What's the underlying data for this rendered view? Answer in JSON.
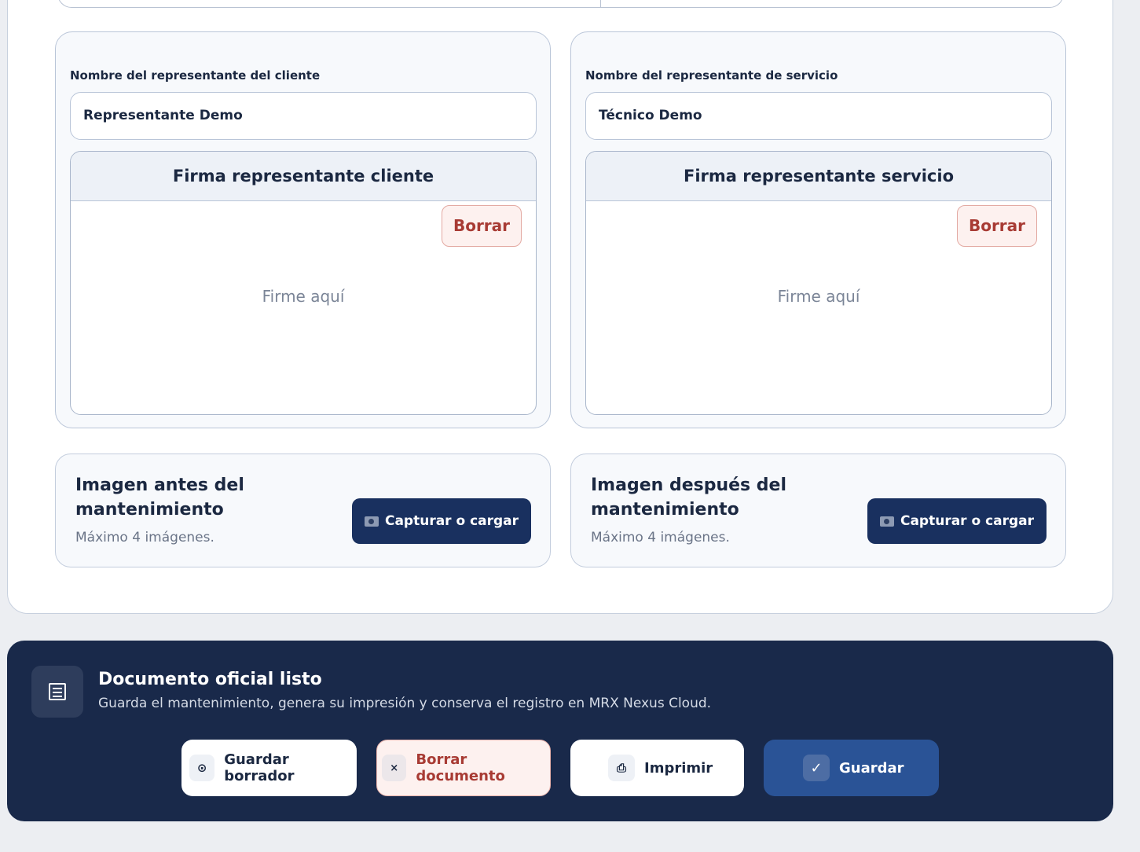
{
  "signatures": {
    "client": {
      "field_label": "Nombre del representante del cliente",
      "name_value": "Representante Demo",
      "box_title": "Firma representante cliente",
      "clear_label": "Borrar",
      "hint": "Firme aquí"
    },
    "service": {
      "field_label": "Nombre del representante de servicio",
      "name_value": "Técnico Demo",
      "box_title": "Firma representante servicio",
      "clear_label": "Borrar",
      "hint": "Firme aquí"
    }
  },
  "images": {
    "before": {
      "title": "Imagen antes del mantenimiento",
      "note": "Máximo 4 imágenes.",
      "button_label": "Capturar o cargar",
      "button_icon": "camera-icon"
    },
    "after": {
      "title": "Imagen después del mantenimiento",
      "note": "Máximo 4 imágenes.",
      "button_label": "Capturar o cargar",
      "button_icon": "camera-icon"
    }
  },
  "footer": {
    "icon": "document-list-icon",
    "title": "Documento oficial listo",
    "subtitle": "Guarda el mantenimiento, genera su impresión y conserva el registro en MRX Nexus Cloud.",
    "buttons": {
      "save_draft": {
        "label": "Guardar borrador",
        "icon": "disk-icon",
        "glyph": "⊙"
      },
      "delete_doc": {
        "label": "Borrar documento",
        "icon": "close-icon",
        "glyph": "×"
      },
      "print": {
        "label": "Imprimir",
        "icon": "printer-icon",
        "glyph": "⎙"
      },
      "save": {
        "label": "Guardar",
        "icon": "check-icon",
        "glyph": "✓"
      }
    }
  },
  "colors": {
    "primary_button": "#19305f",
    "footer_bg": "#19294a",
    "save_button": "#2a5396",
    "danger_text": "#a83b34",
    "danger_bg": "#fdf1ef"
  }
}
